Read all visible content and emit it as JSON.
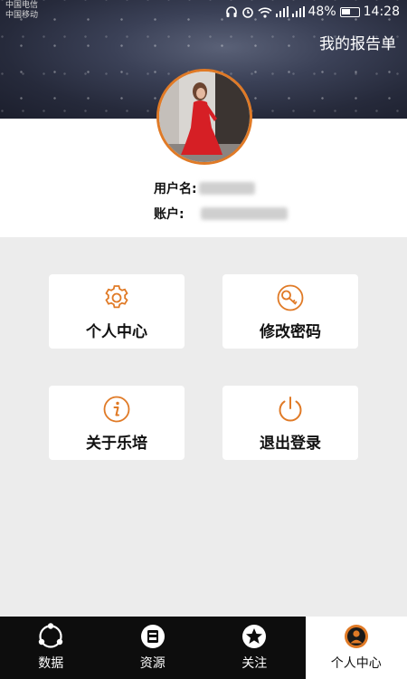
{
  "status_bar": {
    "carrier_line1": "中国电信",
    "carrier_line2": "中国移动",
    "battery": "48%",
    "time": "14:28"
  },
  "header": {
    "report_button": "我的报告单"
  },
  "profile": {
    "username_label": "用户名:",
    "account_label": "账户:"
  },
  "cards": [
    {
      "label": "个人中心",
      "icon": "gear-icon"
    },
    {
      "label": "修改密码",
      "icon": "key-icon"
    },
    {
      "label": "关于乐培",
      "icon": "info-icon"
    },
    {
      "label": "退出登录",
      "icon": "power-icon"
    }
  ],
  "bottom_nav": [
    {
      "label": "数据",
      "icon": "data-icon",
      "active": false
    },
    {
      "label": "资源",
      "icon": "resource-icon",
      "active": false
    },
    {
      "label": "关注",
      "icon": "star-icon",
      "active": false
    },
    {
      "label": "个人中心",
      "icon": "profile-icon",
      "active": true
    }
  ],
  "colors": {
    "accent": "#e07a26",
    "nav_bg": "#0d0d0d",
    "page_bg": "#ececec"
  }
}
